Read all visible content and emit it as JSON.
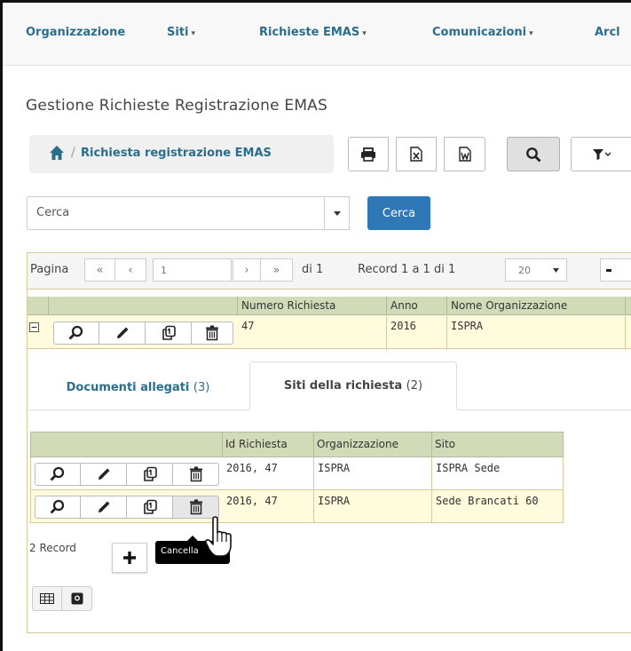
{
  "nav": {
    "items": [
      {
        "label": "Organizzazione",
        "caret": false
      },
      {
        "label": "Siti",
        "caret": true
      },
      {
        "label": "Richieste EMAS",
        "caret": true
      },
      {
        "label": "Comunicazioni",
        "caret": true
      },
      {
        "label": "Arcl",
        "caret": false
      }
    ],
    "caret_glyph": "▾"
  },
  "page": {
    "title": "Gestione Richieste Registrazione EMAS"
  },
  "breadcrumb": {
    "separator": "/",
    "current": "Richiesta registrazione EMAS"
  },
  "search": {
    "placeholder": "Cerca",
    "button_label": "Cerca"
  },
  "pager": {
    "page_label": "Pagina",
    "current_page": "1",
    "of_label": "di 1",
    "records_label": "Record 1 a 1 di 1",
    "page_size": "20"
  },
  "main_grid": {
    "columns": [
      "Numero Richiesta",
      "Anno",
      "Nome Organizzazione"
    ],
    "rows": [
      {
        "numero": "47",
        "anno": "2016",
        "organizzazione": "ISPRA"
      }
    ]
  },
  "tabs": [
    {
      "label": "Documenti allegati",
      "count": "(3)"
    },
    {
      "label": "Siti della richiesta",
      "count": "(2)"
    }
  ],
  "sub_grid": {
    "columns": [
      "Id Richiesta",
      "Organizzazione",
      "Sito"
    ],
    "rows": [
      {
        "id": "2016, 47",
        "organizzazione": "ISPRA",
        "sito": "ISPRA Sede"
      },
      {
        "id": "2016, 47",
        "organizzazione": "ISPRA",
        "sito": "Sede Brancati 60"
      }
    ],
    "record_count": "2 Record"
  },
  "tooltip": {
    "text": "Cancella"
  },
  "colors": {
    "link": "#2a6e8e",
    "primary_button": "#2f78b7",
    "grid_header": "#d2dbb8",
    "highlight_row": "#fffbdc",
    "grid_border": "#d8c99a"
  }
}
